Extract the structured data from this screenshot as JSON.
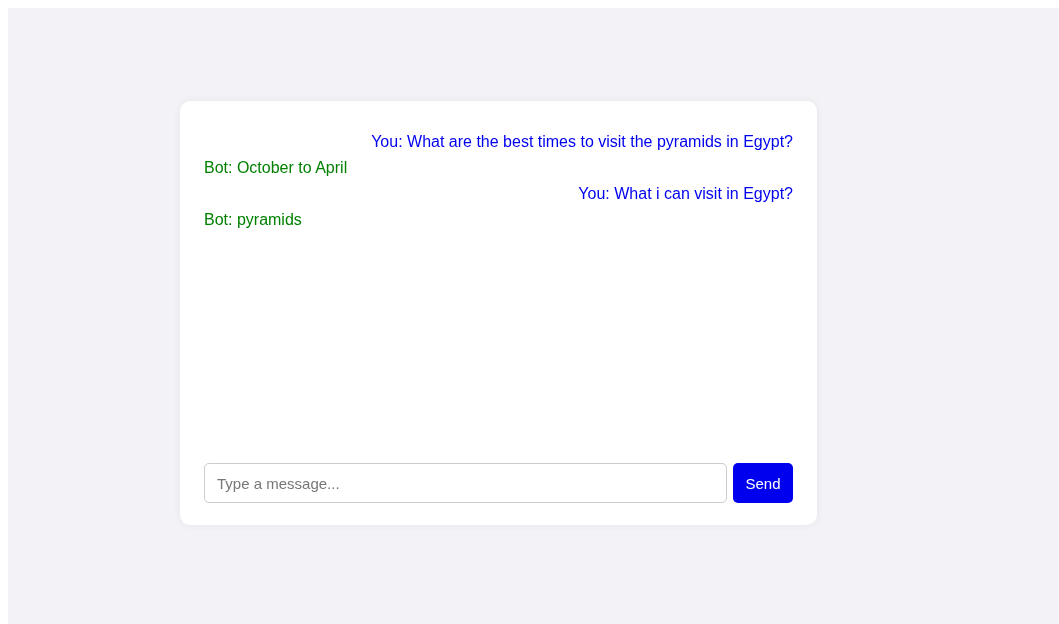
{
  "messages": [
    {
      "kind": "user",
      "text": "You: What are the best times to visit the pyramids in Egypt?"
    },
    {
      "kind": "bot",
      "text": "Bot: October to April"
    },
    {
      "kind": "user",
      "text": "You: What i can visit in Egypt?"
    },
    {
      "kind": "bot",
      "text": "Bot: pyramids"
    }
  ],
  "input": {
    "placeholder": "Type a message..."
  },
  "send_button": "Send"
}
